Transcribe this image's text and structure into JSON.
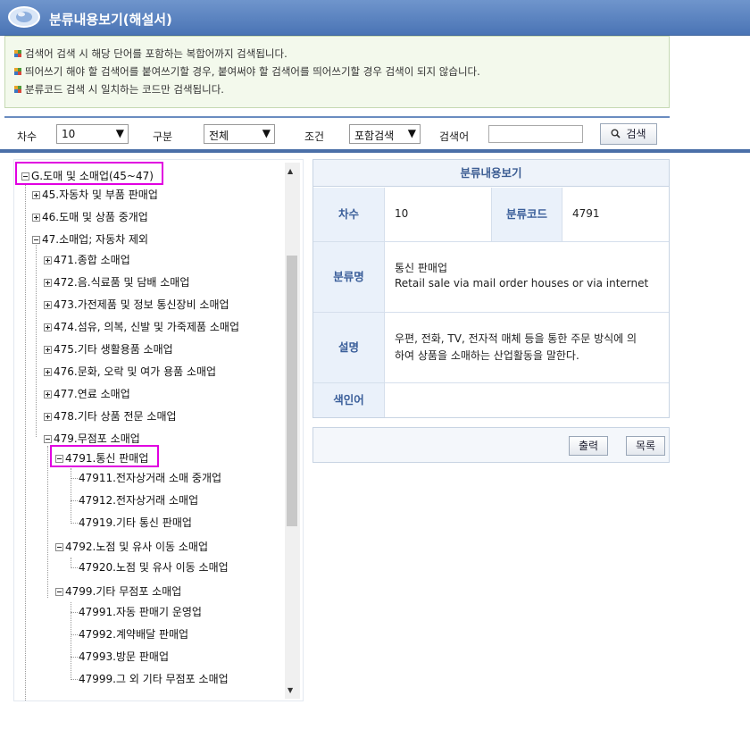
{
  "window": {
    "title": "분류내용보기(해설서)"
  },
  "notices": [
    "검색어 검색 시 해당 단어를 포함하는 복합어까지 검색됩니다.",
    "띄어쓰기 해야 할 검색어를 붙여쓰기할 경우, 붙여써야 할 검색어를 띄어쓰기할 경우 검색이 되지 않습니다.",
    "분류코드 검색 시 일치하는 코드만 검색됩니다."
  ],
  "search": {
    "revision_label": "차수",
    "revision_value": "10",
    "category_label": "구분",
    "category_value": "전체",
    "condition_label": "조건",
    "condition_value": "포함검색",
    "keyword_label": "검색어",
    "keyword_value": "",
    "search_button": "검색"
  },
  "tree": {
    "nodes": [
      {
        "label": "G.도매 및 소매업(45~47)",
        "state": "minus"
      },
      {
        "label": "45.자동차 및 부품 판매업",
        "state": "plus"
      },
      {
        "label": "46.도매 및 상품 중개업",
        "state": "plus"
      },
      {
        "label": "47.소매업; 자동차 제외",
        "state": "minus"
      },
      {
        "label": "471.종합 소매업",
        "state": "plus"
      },
      {
        "label": "472.음.식료품 및 담배 소매업",
        "state": "plus"
      },
      {
        "label": "473.가전제품 및 정보 통신장비 소매업",
        "state": "plus"
      },
      {
        "label": "474.섬유, 의복, 신발 및 가죽제품 소매업",
        "state": "plus"
      },
      {
        "label": "475.기타 생활용품 소매업",
        "state": "plus"
      },
      {
        "label": "476.문화, 오락 및 여가 용품 소매업",
        "state": "plus"
      },
      {
        "label": "477.연료 소매업",
        "state": "plus"
      },
      {
        "label": "478.기타 상품 전문 소매업",
        "state": "plus"
      },
      {
        "label": "479.무점포 소매업",
        "state": "minus"
      },
      {
        "label": "4791.통신 판매업",
        "state": "minus"
      },
      {
        "label": "47911.전자상거래 소매 중개업",
        "state": "leaf"
      },
      {
        "label": "47912.전자상거래 소매업",
        "state": "leaf"
      },
      {
        "label": "47919.기타 통신 판매업",
        "state": "leaf"
      },
      {
        "label": "4792.노점 및 유사 이동 소매업",
        "state": "minus"
      },
      {
        "label": "47920.노점 및 유사 이동 소매업",
        "state": "leaf"
      },
      {
        "label": "4799.기타 무점포 소매업",
        "state": "minus"
      },
      {
        "label": "47991.자동 판매기 운영업",
        "state": "leaf"
      },
      {
        "label": "47992.계약배달 판매업",
        "state": "leaf"
      },
      {
        "label": "47993.방문 판매업",
        "state": "leaf"
      },
      {
        "label": "47999.그 외 기타 무점포 소매업",
        "state": "leaf"
      }
    ]
  },
  "detail": {
    "header": "분류내용보기",
    "revision_label": "차수",
    "revision_value": "10",
    "code_label": "분류코드",
    "code_value": "4791",
    "name_label": "분류명",
    "name_ko": "통신 판매업",
    "name_en": "Retail sale via mail order houses or via internet",
    "desc_label": "설명",
    "desc_line1": "우편, 전화, TV, 전자적 매체 등을 통한 주문 방식에 의",
    "desc_line2": "하여 상품을 소매하는 산업활동을 말한다.",
    "index_label": "색인어",
    "index_value": ""
  },
  "actions": {
    "print_button": "출력",
    "list_button": "목록"
  },
  "colors": {
    "titlebar": "#4a74b5",
    "highlight": "#e100e1",
    "label_text": "#3b5f9a"
  }
}
